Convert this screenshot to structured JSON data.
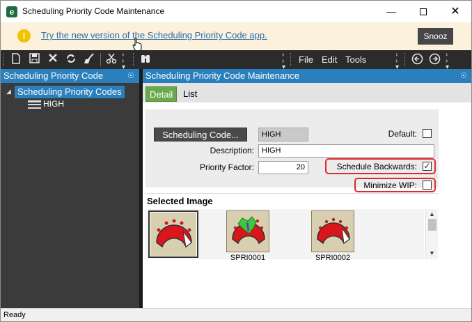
{
  "window": {
    "title": "Scheduling Priority Code Maintenance",
    "minimize_glyph": "—",
    "close_glyph": "✕"
  },
  "notification": {
    "icon_glyph": "!",
    "link_text": "Try the new version of the Scheduling Priority Code app.",
    "snooze_label": "Snooz"
  },
  "toolbar": {
    "icons": [
      "new-icon",
      "save-icon",
      "delete-icon",
      "refresh-icon",
      "clear-icon",
      "cut-icon",
      "binoculars-icon",
      "back-icon",
      "forward-icon"
    ],
    "menus": [
      "File",
      "Edit",
      "Tools"
    ]
  },
  "tree_panel": {
    "header": "Scheduling Priority Code",
    "root_label": "Scheduling Priority Codes",
    "child_label": "HIGH"
  },
  "detail_panel": {
    "header": "Scheduling Priority Code Maintenance",
    "tabs": [
      {
        "label": "Detail",
        "active": true
      },
      {
        "label": "List",
        "active": false
      }
    ]
  },
  "form": {
    "code_button_label": "Scheduling Code...",
    "code_value": "HIGH",
    "default_label": "Default:",
    "default_checked": false,
    "description_label": "Description:",
    "description_value": "HIGH",
    "priority_factor_label": "Priority Factor:",
    "priority_factor_value": "20",
    "schedule_backwards_label": "Schedule Backwards:",
    "schedule_backwards_checked": true,
    "minimize_wip_label": "Minimize WIP:",
    "minimize_wip_checked": false
  },
  "images": {
    "section_title": "Selected Image",
    "items": [
      {
        "caption": "",
        "selected": true
      },
      {
        "caption": "SPRI0001",
        "selected": false
      },
      {
        "caption": "SPRI0002",
        "selected": false
      }
    ]
  },
  "status": {
    "text": "Ready"
  },
  "colors": {
    "accent": "#2a7fbd",
    "tab_active": "#6aa84f",
    "highlight": "#e0282d",
    "toolbar": "#2b2b2b",
    "notification_bg": "#fbf1dd"
  }
}
